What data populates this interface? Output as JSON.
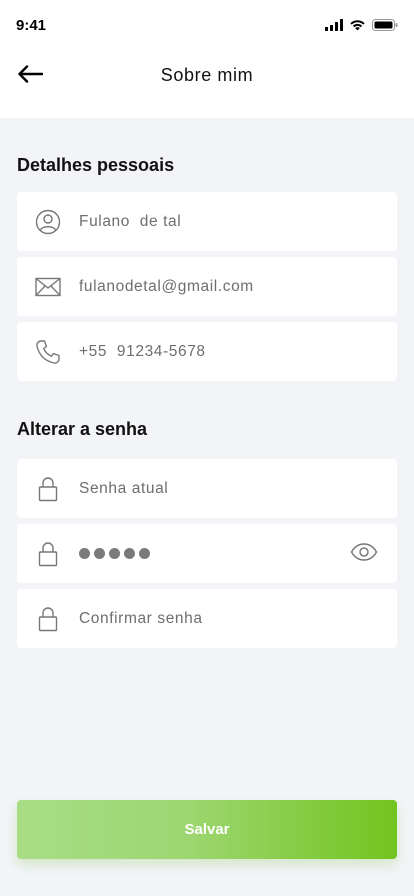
{
  "status_bar": {
    "time": "9:41"
  },
  "header": {
    "title": "Sobre mim",
    "back_icon": "arrow-left-icon"
  },
  "personal_details": {
    "title": "Detalhes pessoais",
    "name": {
      "value": "Fulano  de tal",
      "icon": "user-icon"
    },
    "email": {
      "value": "fulanodetal@gmail.com",
      "icon": "mail-icon"
    },
    "phone": {
      "value": "+55  91234-5678",
      "icon": "phone-icon"
    }
  },
  "change_password": {
    "title": "Alterar a senha",
    "current": {
      "placeholder": "Senha atual",
      "icon": "lock-icon"
    },
    "new": {
      "masked_length": 5,
      "icon": "lock-icon",
      "toggle_icon": "eye-icon"
    },
    "confirm": {
      "placeholder": "Confirmar senha",
      "icon": "lock-icon"
    }
  },
  "actions": {
    "save_label": "Salvar"
  },
  "colors": {
    "accent_start": "#a8dd86",
    "accent_end": "#72c41f",
    "background": "#f3f4f8"
  }
}
